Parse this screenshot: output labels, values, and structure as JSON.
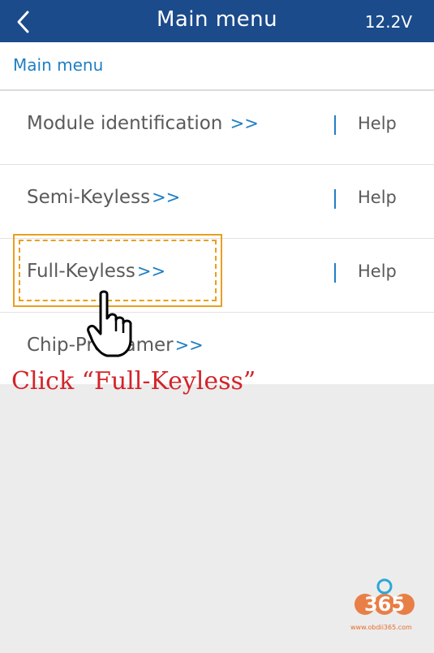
{
  "header": {
    "title": "Main menu",
    "voltage": "12.2V",
    "back_icon": "chevron-left-icon"
  },
  "breadcrumb": {
    "label": "Main menu"
  },
  "menu": {
    "items": [
      {
        "label": "Module identification ",
        "arrow": ">>",
        "help": "Help"
      },
      {
        "label": "Semi-Keyless",
        "arrow": ">>",
        "help": "Help"
      },
      {
        "label": "Full-Keyless",
        "arrow": ">>",
        "help": "Help"
      },
      {
        "label": "Chip-Programer",
        "arrow": ">>",
        "help": ""
      }
    ],
    "separator": "|"
  },
  "annotation": {
    "instruction": "Click “Full-Keyless”",
    "highlight_color": "#e8a020",
    "instruction_color": "#d3242a"
  },
  "watermark": {
    "logo_text": "365",
    "url": "www.obdii365.com"
  },
  "colors": {
    "header_bg": "#1b4b8b",
    "accent": "#1f7fc4",
    "text": "#5a5a5a",
    "background": "#ececec"
  }
}
